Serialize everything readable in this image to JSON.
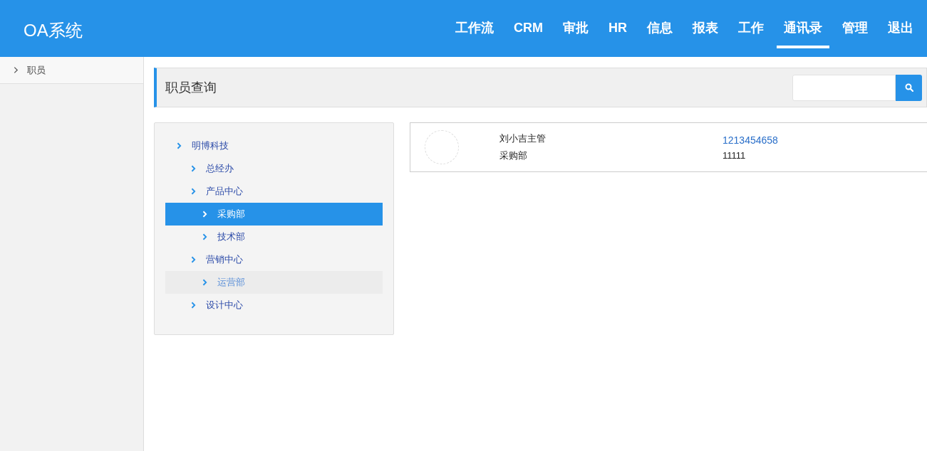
{
  "header": {
    "logo": "OA系统",
    "nav": [
      {
        "label": "工作流",
        "selected": false
      },
      {
        "label": "CRM",
        "selected": false
      },
      {
        "label": "审批",
        "selected": false
      },
      {
        "label": "HR",
        "selected": false
      },
      {
        "label": "信息",
        "selected": false
      },
      {
        "label": "报表",
        "selected": false
      },
      {
        "label": "工作",
        "selected": false
      },
      {
        "label": "通讯录",
        "selected": true
      },
      {
        "label": "管理",
        "selected": false
      },
      {
        "label": "退出",
        "selected": false
      }
    ]
  },
  "sidebar": {
    "items": [
      {
        "label": "职员"
      }
    ]
  },
  "page": {
    "title": "职员查询"
  },
  "tree": [
    {
      "label": "明博科技",
      "selected": false,
      "hovered": false,
      "children": [
        {
          "label": "总经办",
          "selected": false,
          "hovered": false
        },
        {
          "label": "产品中心",
          "selected": false,
          "hovered": false,
          "children": [
            {
              "label": "采购部",
              "selected": true,
              "hovered": false
            },
            {
              "label": "技术部",
              "selected": false,
              "hovered": false
            }
          ]
        },
        {
          "label": "营销中心",
          "selected": false,
          "hovered": false,
          "children": [
            {
              "label": "运营部",
              "selected": false,
              "hovered": true
            }
          ]
        },
        {
          "label": "设计中心",
          "selected": false,
          "hovered": false
        }
      ]
    }
  ],
  "employees": [
    {
      "name": "刘小吉主管",
      "department": "采购部",
      "phone": "1213454658",
      "extension": "11111"
    }
  ]
}
